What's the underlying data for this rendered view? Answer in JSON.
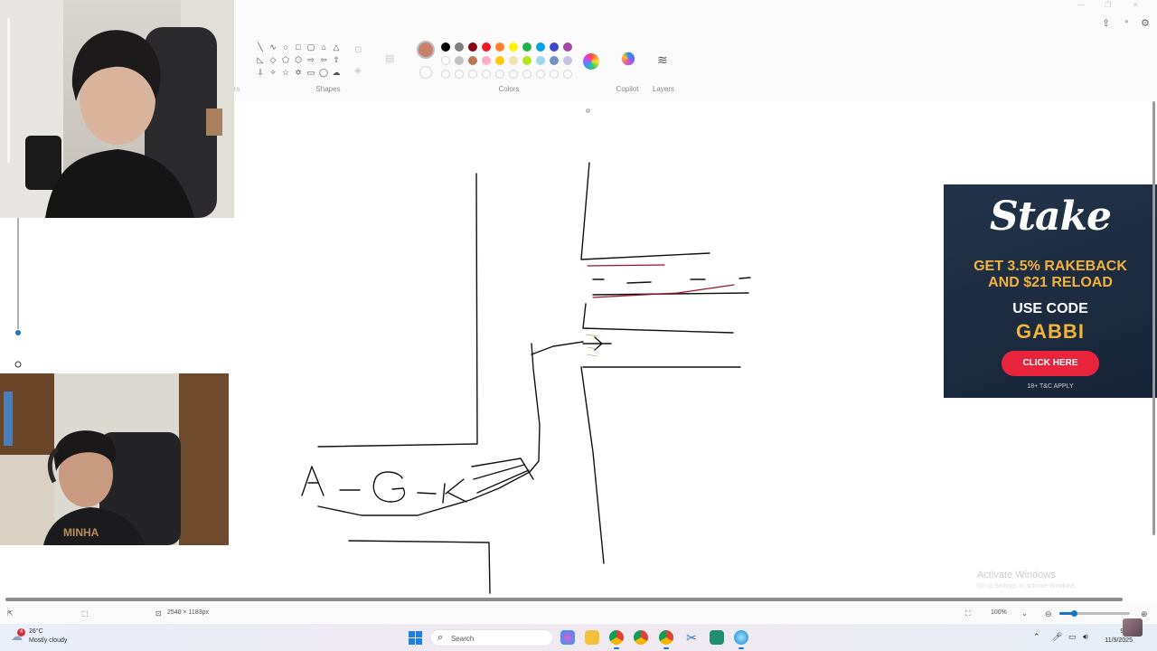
{
  "ribbon": {
    "shapes_label": "Shapes",
    "colors_label": "Colors",
    "copilot_label": "Copilot",
    "layers_label": "Layers",
    "current_color": "#c8806a",
    "palette_row1": [
      "#000000",
      "#7f7f7f",
      "#880015",
      "#ed1c24",
      "#ff7f27",
      "#fff200",
      "#22b14c",
      "#00a2e8",
      "#3f48cc",
      "#a349a4"
    ],
    "palette_row2": [
      "#ffffff",
      "#c3c3c3",
      "#b97a57",
      "#ffaec9",
      "#ffc90e",
      "#efe4b0",
      "#b5e61d",
      "#99d9ea",
      "#7092be",
      "#c8bfe7"
    ]
  },
  "ad": {
    "brand": "Stake",
    "headline": "GET 3.5% RAKEBACK AND $21 RELOAD",
    "use_code": "USE CODE",
    "code": "GABBI",
    "cta": "CLICK HERE",
    "terms": "18+  T&C APPLY"
  },
  "canvas": {
    "handwriting": "A-G-K"
  },
  "watermark": {
    "title": "Activate Windows",
    "subtitle": "Go to Settings to activate Windows."
  },
  "statusbar": {
    "canvas_size": "2540 × 1183px",
    "zoom": "100%"
  },
  "taskbar": {
    "temperature": "26°C",
    "weather": "Mostly cloudy",
    "weather_badge": "4",
    "search_placeholder": "Search",
    "time": "9:49",
    "date": "11/9/2025"
  }
}
